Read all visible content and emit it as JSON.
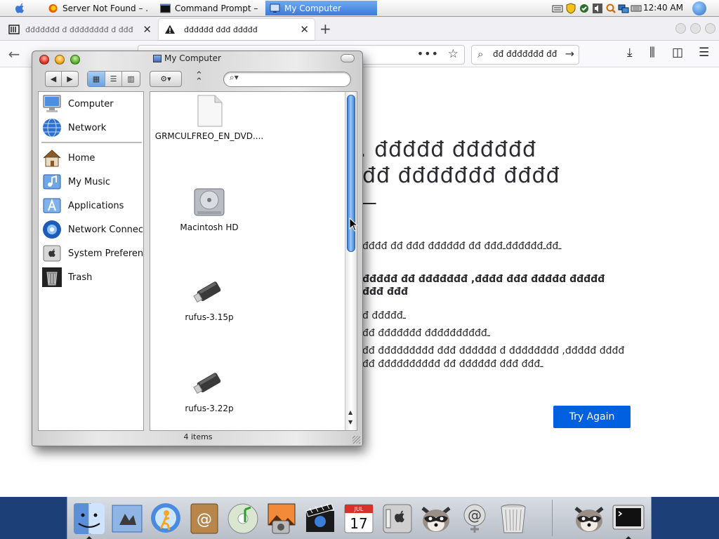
{
  "menubar": {
    "tasks": [
      {
        "label": "Server Not Found – ...",
        "icon": "firefox-icon"
      },
      {
        "label": "Command Prompt – ...",
        "icon": "cmd-icon"
      },
      {
        "label": "My Computer",
        "icon": "finder-window-icon",
        "active": true
      }
    ],
    "clock": "12:40 AM"
  },
  "firefox": {
    "tabs": [
      {
        "label": "đđđđđđđ đ đđđđđđđđ đ  đđđ",
        "icon": "library-icon"
      },
      {
        "label": "đđđđđđ đđđ đđđđđ",
        "icon": "warning-icon",
        "active": true
      }
    ],
    "search_text": "đđ đđđđđđđ đđ",
    "error": {
      "title_line1": ". đđđđđ đđđđđđ",
      "title_line2": "đđ đđđđđđđ đđđđ",
      "title_line3": "ـــ",
      "intro": "đđđđ đđ đđđ đđđđđđ đđ đđđـđđđđđđـđđـ",
      "bold_line1": "đđđđđ đđ đđđđđđđ ,đđđđ đđđ đđđđđ đđđđđ",
      "bold_line2": "đđđ đđđ",
      "bullet1": "đ đđđđđـ",
      "bullet2": "đđ đđđđđđđ đđđđđđđđđđـ",
      "bullet3a": "đđ đđđđđđđđđ đđđ đđđđđđ đ đđđđđđđđ ,đđđđđ đđđđ",
      "bullet3b": "đđ đđđđđđđđđđ đđ đđđđđđ đđđ đđđـ"
    },
    "try_again": "Try Again"
  },
  "finder": {
    "title": "My Computer",
    "view_mode": "icon",
    "search_placeholder": "",
    "sidebar": [
      {
        "label": "Computer",
        "icon": "computer-icon"
      },
      {
        "label": "Network",
        "icon": "network-globe-icon"
      },
      {
        "label": "Home",
        "icon": "home-icon"
      },
      {
        "label": "My Music",
        "icon": "music-icon"
      },
      {
        "label": "Applications",
        "icon": "applications-icon"
      },
      {
        "label": "Network Connec",
        "icon": "network-connections-icon"
      },
      {
        "label": "System Preferenc",
        "icon": "system-preferences-icon"
      },
      {
        "label": "Trash",
        "icon": "trash-icon"
      }
    ],
    "items": [
      {
        "label": "GRMCULFREO_EN_DVD....",
        "icon": "document-icon"
      },
      {
        "label": "Macintosh HD",
        "icon": "hard-drive-icon"
      },
      {
        "label": "rufus-3.15p",
        "icon": "usb-drive-icon"
      },
      {
        "label": "rufus-3.22p",
        "icon": "usb-drive-icon"
      }
    ],
    "status": "4 items"
  },
  "dock": {
    "apps": [
      "finder-icon",
      "mail-icon",
      "ichat-icon",
      "address-book-icon",
      "itunes-icon",
      "iphoto-icon",
      "imovie-icon",
      "ical-icon",
      "system-preferences-icon",
      "raccoon-icon",
      "mail-at-icon",
      "trash-icon",
      "raccoon-icon",
      "terminal-icon"
    ],
    "ical_month": "JUL",
    "ical_day": "17"
  },
  "colors": {
    "accent": "#0060df",
    "dock_blue": "#1d3f78",
    "active_task": "#3b7bdc"
  }
}
